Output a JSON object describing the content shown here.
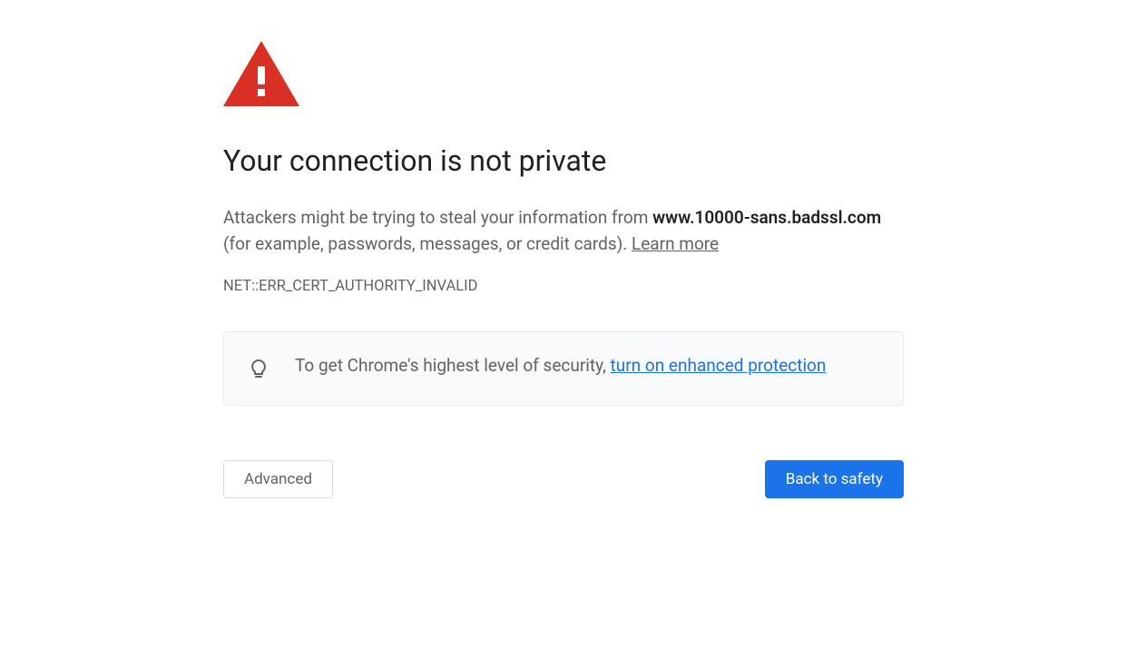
{
  "icon": {
    "warning_color": "#d93025",
    "exclaim_color": "#ffffff"
  },
  "heading": "Your connection is not private",
  "body": {
    "prefix": "Attackers might be trying to steal your information from ",
    "hostname": "www.10000-sans.badssl.com",
    "suffix": " (for example, passwords, messages, or credit cards). ",
    "learn_more": "Learn more"
  },
  "error_code": "NET::ERR_CERT_AUTHORITY_INVALID",
  "promo": {
    "text": "To get Chrome's highest level of security, ",
    "link": "turn on enhanced protection"
  },
  "buttons": {
    "advanced": "Advanced",
    "primary": "Back to safety"
  },
  "colors": {
    "link": "#1a73e8",
    "primary_button": "#1a73e8",
    "text_secondary": "#5f6368"
  }
}
